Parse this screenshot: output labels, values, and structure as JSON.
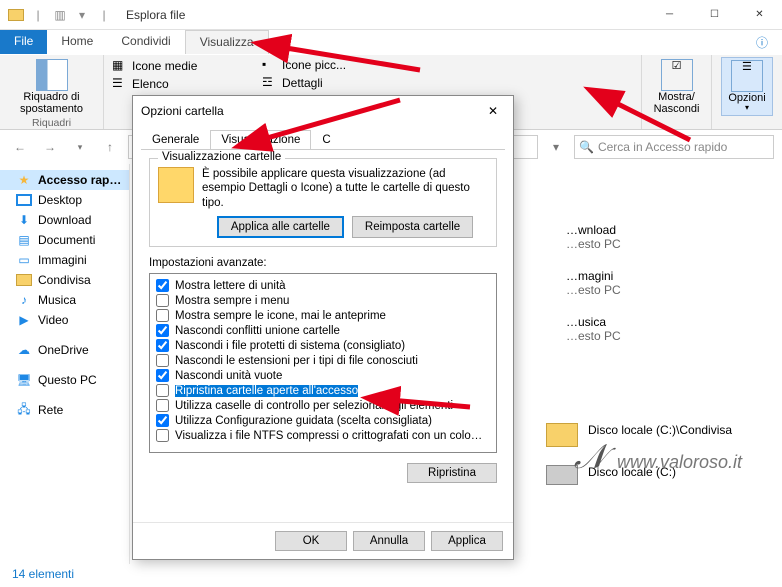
{
  "titlebar": {
    "title": "Esplora file"
  },
  "ribbon_tabs": {
    "file": "File",
    "home": "Home",
    "share": "Condividi",
    "view": "Visualizza"
  },
  "ribbon": {
    "navpane_btn": "Riquadro di\nspostamento",
    "navpane_group": "Riquadri",
    "layout_medium": "Icone medie",
    "layout_small": "Icone picc...",
    "layout_list": "Elenco",
    "layout_details": "Dettagli",
    "showhide_btn": "Mostra/\nNascondi",
    "options_btn": "Opzioni"
  },
  "search_placeholder": "Cerca in Accesso rapido",
  "sidebar": {
    "items": [
      {
        "label": "Accesso rap…",
        "kind": "star"
      },
      {
        "label": "Desktop",
        "kind": "screen"
      },
      {
        "label": "Download",
        "kind": "folder"
      },
      {
        "label": "Documenti",
        "kind": "folder"
      },
      {
        "label": "Immagini",
        "kind": "folder"
      },
      {
        "label": "Condivisa",
        "kind": "folder"
      },
      {
        "label": "Musica",
        "kind": "folder"
      },
      {
        "label": "Video",
        "kind": "folder"
      },
      {
        "label": "OneDrive",
        "kind": "cloud"
      },
      {
        "label": "Questo PC",
        "kind": "pc"
      },
      {
        "label": "Rete",
        "kind": "net"
      }
    ]
  },
  "content": {
    "items": [
      {
        "name": "…wnload",
        "sub": "…esto PC"
      },
      {
        "name": "…magini",
        "sub": "…esto PC"
      },
      {
        "name": "…usica",
        "sub": "…esto PC"
      },
      {
        "name": "Disco locale (C:)\\Condivisa",
        "sub": ""
      },
      {
        "name": "Disco locale (C:)",
        "sub": ""
      }
    ]
  },
  "status": "14 elementi",
  "dialog": {
    "title": "Opzioni cartella",
    "tabs": {
      "general": "Generale",
      "view": "Visualizzazione",
      "search_prefix": "C"
    },
    "group_title": "Visualizzazione cartelle",
    "group_desc": "È possibile applicare questa visualizzazione (ad esempio Dettagli o Icone) a tutte le cartelle di questo tipo.",
    "apply_all": "Applica alle cartelle",
    "reset_all": "Reimposta cartelle",
    "advanced_label": "Impostazioni avanzate:",
    "restore": "Ripristina",
    "ok": "OK",
    "cancel": "Annulla",
    "apply": "Applica",
    "adv": [
      {
        "checked": true,
        "label": "Mostra lettere di unità"
      },
      {
        "checked": false,
        "label": "Mostra sempre i menu"
      },
      {
        "checked": false,
        "label": "Mostra sempre le icone, mai le anteprime"
      },
      {
        "checked": true,
        "label": "Nascondi conflitti unione cartelle"
      },
      {
        "checked": true,
        "label": "Nascondi i file protetti di sistema (consigliato)"
      },
      {
        "checked": false,
        "label": "Nascondi le estensioni per i tipi di file conosciuti"
      },
      {
        "checked": true,
        "label": "Nascondi unità vuote"
      },
      {
        "checked": false,
        "label": "Ripristina cartelle aperte all'accesso",
        "highlight": true
      },
      {
        "checked": false,
        "label": "Utilizza caselle di controllo per selezionare gli elementi"
      },
      {
        "checked": true,
        "label": "Utilizza Configurazione guidata (scelta consigliata)"
      },
      {
        "checked": false,
        "label": "Visualizza i file NTFS compressi o crittografati con un colo…"
      }
    ]
  },
  "watermark": "www.valoroso.it"
}
